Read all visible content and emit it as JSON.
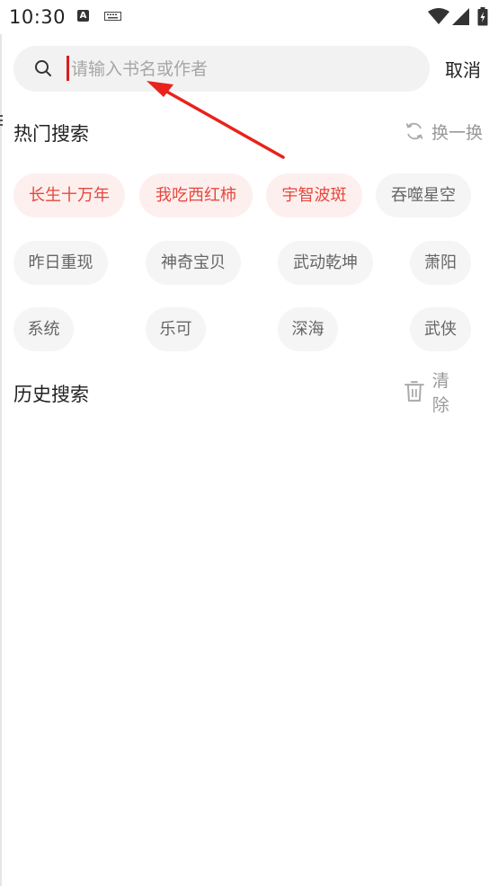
{
  "status_bar": {
    "time": "10:30",
    "icons": [
      "a-notification-icon",
      "keyboard-icon",
      "wifi-icon",
      "signal-icon",
      "battery-icon"
    ]
  },
  "search": {
    "placeholder": "请输入书名或作者",
    "value": "",
    "cancel_label": "取消"
  },
  "hot_search": {
    "title": "热门搜索",
    "refresh_label": "换一换",
    "keywords": [
      {
        "label": "长生十万年",
        "highlight": true
      },
      {
        "label": "我吃西红柿",
        "highlight": true
      },
      {
        "label": "宇智波斑",
        "highlight": true
      },
      {
        "label": "吞噬星空",
        "highlight": false
      },
      {
        "label": "昨日重现",
        "highlight": false
      },
      {
        "label": "神奇宝贝",
        "highlight": false
      },
      {
        "label": "武动乾坤",
        "highlight": false
      },
      {
        "label": "萧阳",
        "highlight": false
      },
      {
        "label": "系统",
        "highlight": false
      },
      {
        "label": "乐可",
        "highlight": false
      },
      {
        "label": "深海",
        "highlight": false
      },
      {
        "label": "武侠",
        "highlight": false
      }
    ]
  },
  "history_search": {
    "title": "历史搜索",
    "clear_label": "清除",
    "items": []
  },
  "colors": {
    "accent": "#e5483d",
    "hot_chip_bg": "#fdefee",
    "chip_bg": "#f5f5f5",
    "search_bg": "#f2f2f2",
    "caret": "#d81e1e",
    "annotation_arrow": "#e8231b"
  }
}
